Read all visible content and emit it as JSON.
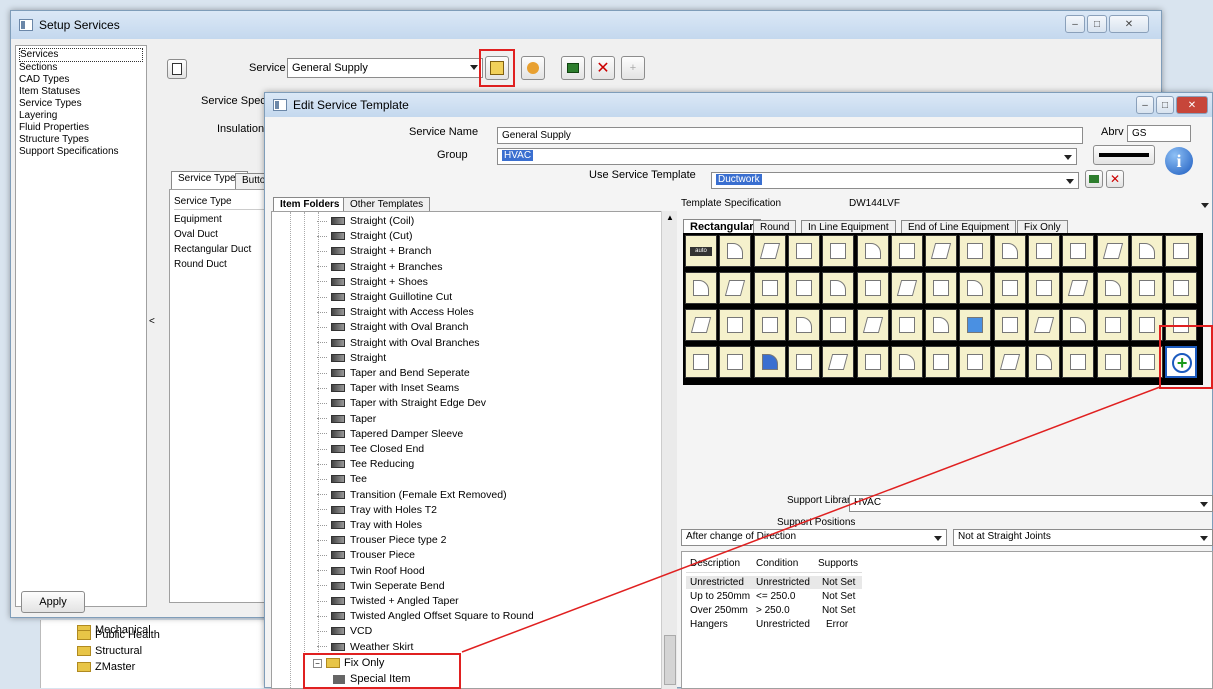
{
  "setup_window": {
    "title": "Setup Services",
    "nav_items": [
      "Services",
      "Sections",
      "CAD Types",
      "Item Statuses",
      "Service Types",
      "Layering",
      "Fluid Properties",
      "Structure Types",
      "Support Specifications"
    ],
    "service_label": "Service",
    "service_value": "General Supply",
    "service_spec_label": "Service Specifica",
    "insulation_label": "Insulation S",
    "tabs": [
      "Service Types",
      "Button"
    ],
    "service_types_header": "Service Type",
    "service_types": [
      "Equipment",
      "Oval Duct",
      "Rectangular Duct",
      "Round Duct"
    ],
    "apply_label": "Apply",
    "collapse_arrow": "<"
  },
  "background_tree": {
    "items": [
      "Mechanical",
      "Public Health",
      "Structural",
      "ZMaster"
    ]
  },
  "edit_window": {
    "title": "Edit Service Template",
    "service_name_label": "Service Name",
    "service_name_value": "General Supply",
    "abrv_label": "Abrv",
    "abrv_value": "GS",
    "group_label": "Group",
    "group_value": "HVAC",
    "use_template_label": "Use Service Template",
    "use_template_value": "Ductwork",
    "folder_tabs": [
      "Item Folders",
      "Other Templates"
    ],
    "tree_items": [
      "Straight (Coil)",
      "Straight (Cut)",
      "Straight + Branch",
      "Straight + Branches",
      "Straight + Shoes",
      "Straight Guillotine Cut",
      "Straight with Access Holes",
      "Straight with Oval Branch",
      "Straight with Oval Branches",
      "Straight",
      "Taper and Bend Seperate",
      "Taper with Inset Seams",
      "Taper with Straight Edge Dev",
      "Taper",
      "Tapered Damper Sleeve",
      "Tee Closed End",
      "Tee Reducing",
      "Tee",
      "Transition (Female Ext Removed)",
      "Tray with Holes T2",
      "Tray with Holes",
      "Trouser Piece type 2",
      "Trouser Piece",
      "Twin Roof Hood",
      "Twin Seperate Bend",
      "Twisted + Angled Taper",
      "Twisted Angled Offset Square to Round",
      "VCD",
      "Weather Skirt"
    ],
    "fix_only_folder": "Fix Only",
    "special_item": "Special Item",
    "template_spec_label": "Template Specification",
    "template_spec_value": "DW144LVF",
    "shape_tabs": [
      "Rectangular",
      "Round",
      "In Line Equipment",
      "End of Line Equipment",
      "Fix Only"
    ],
    "support_library_label": "Support Library",
    "support_library_value": "HVAC",
    "support_positions_label": "Support Positions",
    "support_pos_1": "After change of Direction",
    "support_pos_2": "Not at Straight Joints",
    "support_table_headers": [
      "Description",
      "Condition",
      "Supports"
    ],
    "support_rows": [
      [
        "Unrestricted",
        "Unrestricted",
        "Not Set"
      ],
      [
        "Up to 250mm",
        "<= 250.0",
        "Not Set"
      ],
      [
        "Over 250mm",
        "> 250.0",
        "Not Set"
      ],
      [
        "Hangers",
        "Unrestricted",
        "Error"
      ]
    ],
    "auto_cell_label": "auto"
  },
  "colors": {
    "highlight_red": "#e02020",
    "selection_blue": "#3a6fd0",
    "cell_yellow": "#f5f1cc"
  }
}
